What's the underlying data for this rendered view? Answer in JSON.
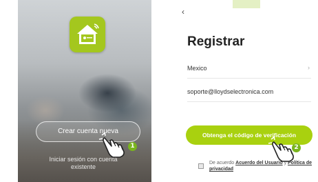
{
  "left_screen": {
    "create_account_label": "Crear cuenta nueva",
    "login_link_label": "Iniciar sesión con cuenta existente"
  },
  "right_screen": {
    "back_icon": "chevron-left-icon",
    "title": "Registrar",
    "country_value": "Mexico",
    "email_value": "soporte@lloydselectronica.com",
    "code_button_label": "Obtenga el código de verificación",
    "agree_prefix": "De acuerdo",
    "agree_link_1": "Acuerdo del Usuario",
    "agree_mid": " y ",
    "agree_link_2": "Política de privacidad"
  },
  "steps": {
    "step_1": "1",
    "step_2": "2"
  },
  "colors": {
    "brand_green": "#a9d10f",
    "badge_green": "#7ab51d"
  }
}
